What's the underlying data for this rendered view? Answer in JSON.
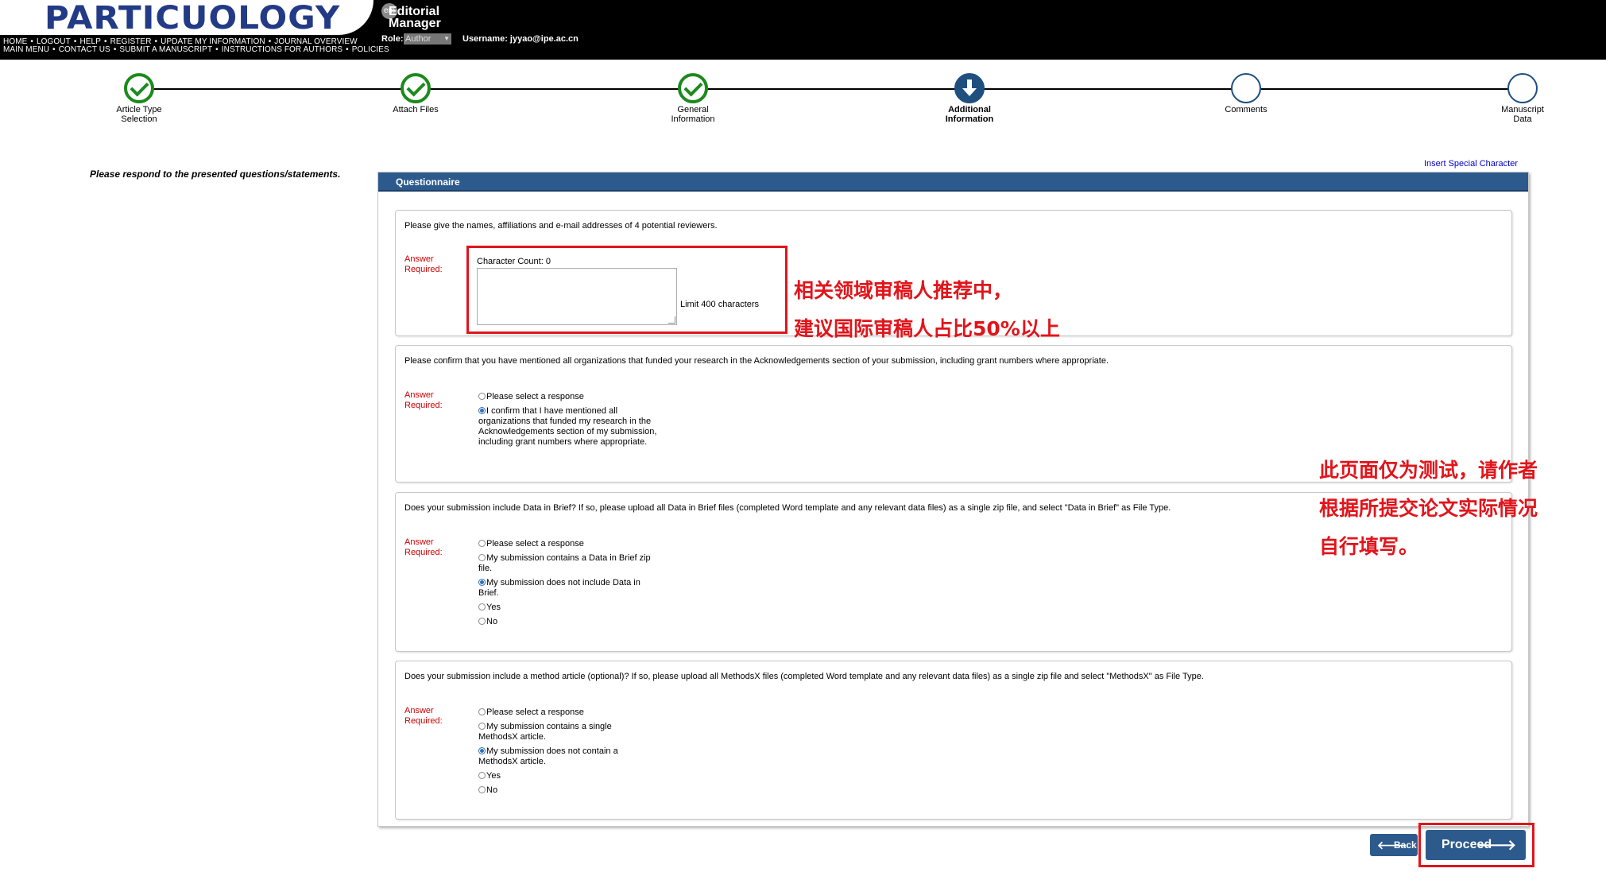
{
  "header": {
    "logo": "PARTICUOLOGY",
    "em_badge": "em",
    "em_title_line1": "Editorial",
    "em_title_line2": "Manager",
    "nav_row1": [
      "HOME",
      "LOGOUT",
      "HELP",
      "REGISTER",
      "UPDATE MY INFORMATION",
      "JOURNAL OVERVIEW"
    ],
    "nav_row2": [
      "MAIN MENU",
      "CONTACT US",
      "SUBMIT A MANUSCRIPT",
      "INSTRUCTIONS FOR AUTHORS",
      "POLICIES"
    ],
    "role_label": "Role:",
    "role_value": "Author",
    "username": "Username: jyyao@ipe.ac.cn"
  },
  "steps": [
    {
      "line1": "Article Type",
      "line2": "Selection",
      "state": "done"
    },
    {
      "line1": "Attach Files",
      "line2": "",
      "state": "done"
    },
    {
      "line1": "General",
      "line2": "Information",
      "state": "done"
    },
    {
      "line1": "Additional",
      "line2": "Information",
      "state": "current"
    },
    {
      "line1": "Comments",
      "line2": "",
      "state": "todo"
    },
    {
      "line1": "Manuscript",
      "line2": "Data",
      "state": "todo"
    }
  ],
  "main": {
    "instructions": "Please respond to the presented questions/statements.",
    "insert_special": "Insert Special Character",
    "panel_title": "Questionnaire"
  },
  "q1": {
    "text": "Please give the names, affiliations and e-mail addresses of 4 potential reviewers.",
    "required_line1": "Answer",
    "required_line2": "Required:",
    "char_count": "Character Count: 0",
    "limit": "Limit 400 characters"
  },
  "q2": {
    "text": "Please confirm that you have mentioned all organizations that funded your research in the Acknowledgements section of your submission, including grant numbers where appropriate.",
    "required_line1": "Answer",
    "required_line2": "Required:",
    "options": [
      "Please select a response",
      "I confirm that I have mentioned all organizations that funded my research in the Acknowledgements section of my submission, including grant numbers where appropriate."
    ]
  },
  "q3": {
    "text": "Does your submission include Data in Brief? If so, please upload all Data in Brief files (completed Word template and any relevant data files) as a single zip file, and select \"Data in Brief\" as File Type.",
    "required_line1": "Answer",
    "required_line2": "Required:",
    "options": [
      "Please select a response",
      "My submission contains a Data in Brief zip file.",
      "My submission does not include Data in Brief.",
      "Yes",
      "No"
    ]
  },
  "q4": {
    "text": "Does your submission include a method article (optional)? If so, please upload all MethodsX files (completed Word template and any relevant data files) as a single zip file and select \"MethodsX\" as File Type.",
    "required_line1": "Answer",
    "required_line2": "Required:",
    "options": [
      "Please select a response",
      "My submission contains a single MethodsX article.",
      "My submission does not contain a MethodsX article.",
      "Yes",
      "No"
    ]
  },
  "annotations": {
    "note1_line1": "相关领域审稿人推荐中，",
    "note1_line2": "建议国际审稿人占比50%以上",
    "note2_line1": "此页面仅为测试，请作者",
    "note2_line2": "根据所提交论文实际情况",
    "note2_line3": "自行填写。"
  },
  "buttons": {
    "back": "Back",
    "proceed": "Proceed"
  },
  "colors": {
    "header_bg": "#000000",
    "logo": "#233a86",
    "accent_blue": "#2d5a8c",
    "done_green": "#1c8a1c",
    "required_red": "#cc0000",
    "annotation_red": "#e0151b"
  }
}
